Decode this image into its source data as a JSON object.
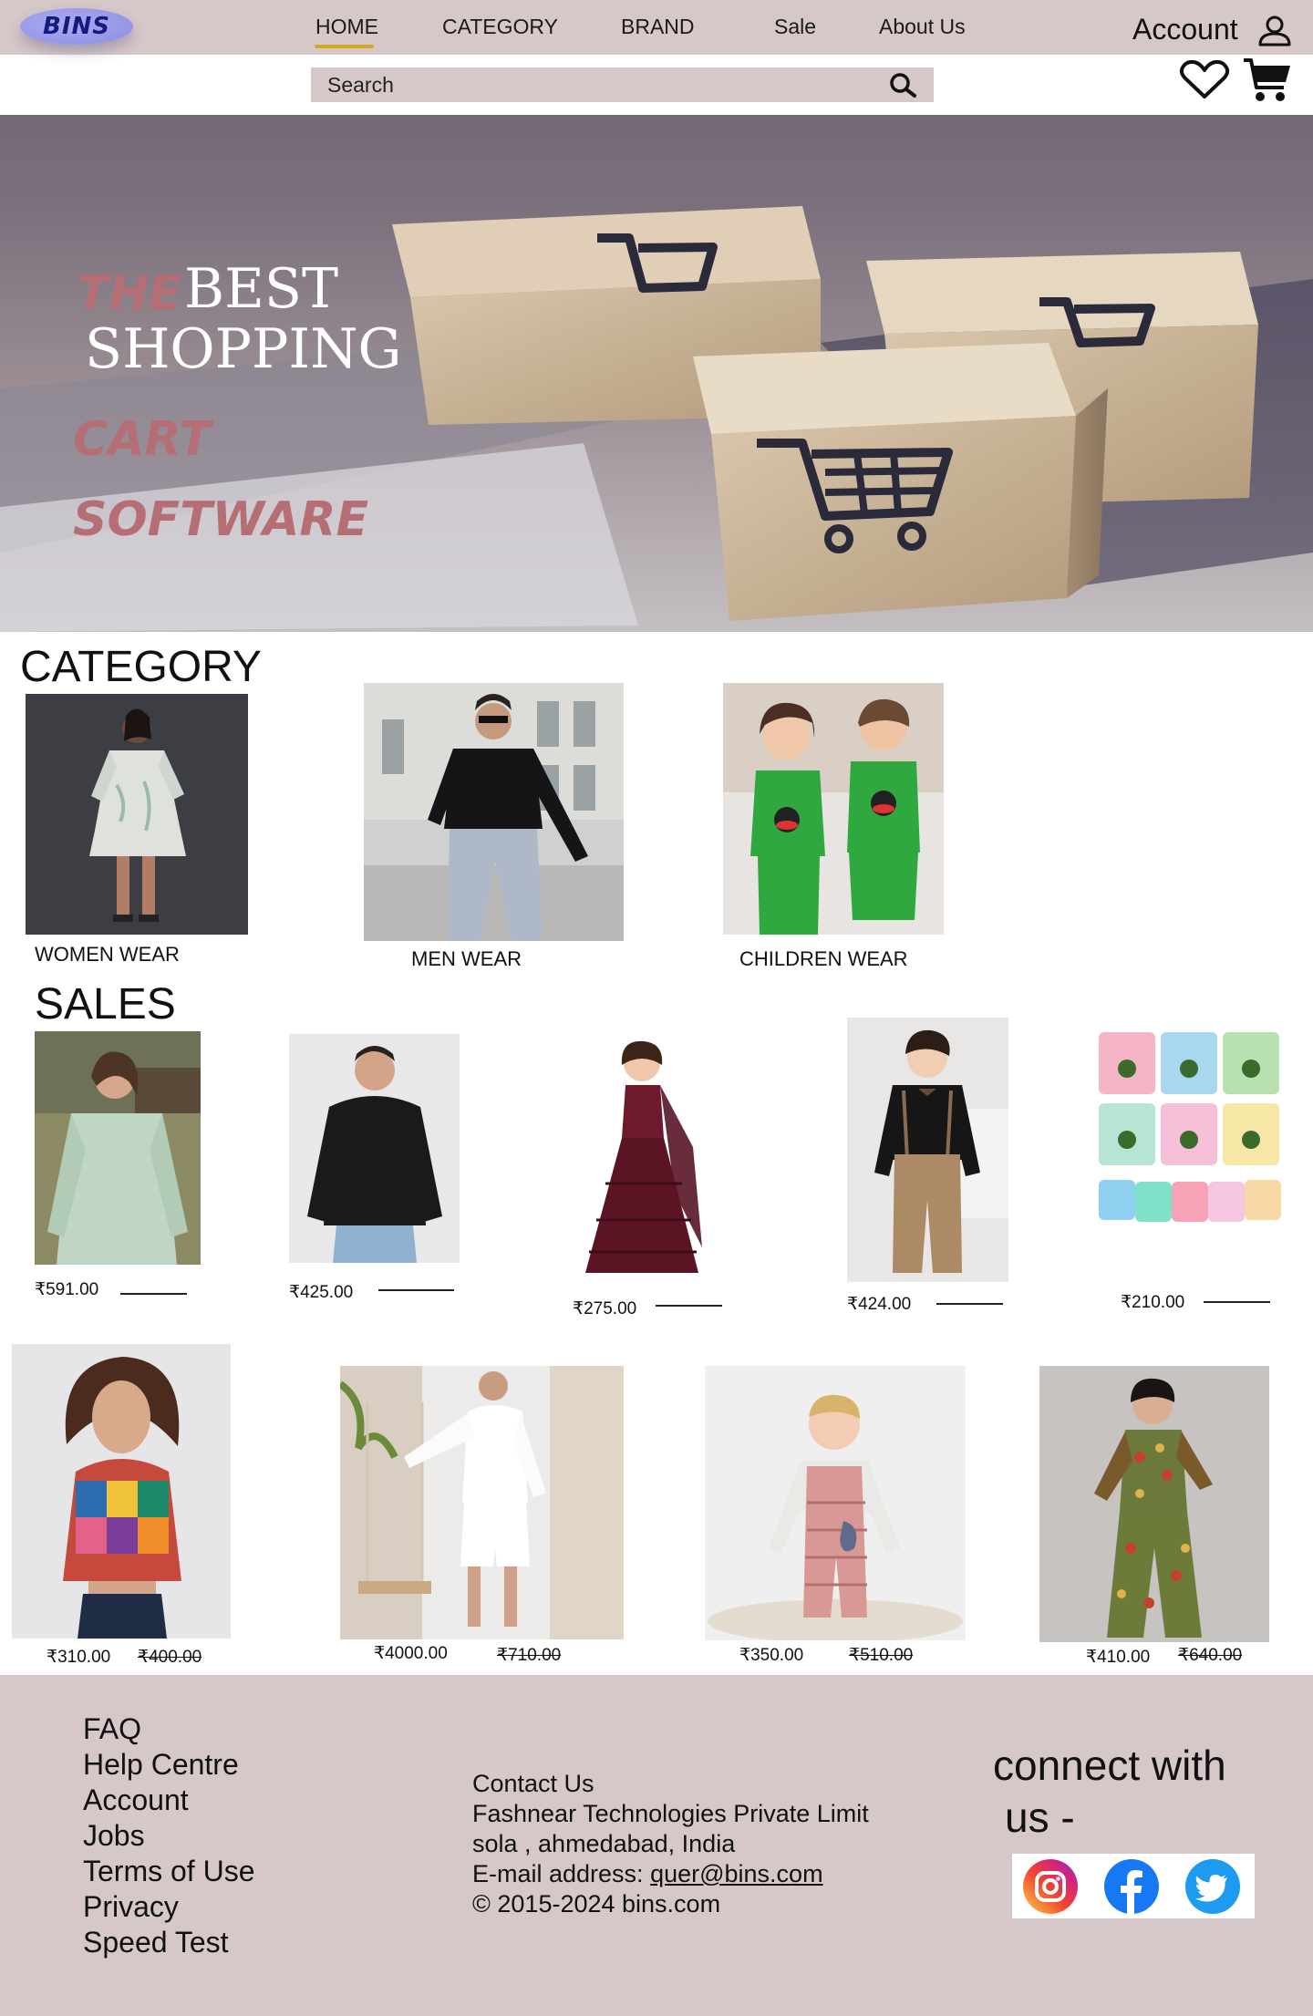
{
  "brand": {
    "logo_text": "BINS"
  },
  "nav": {
    "items": [
      {
        "label": "HOME",
        "active": true
      },
      {
        "label": "CATEGORY"
      },
      {
        "label": "BRAND"
      },
      {
        "label": "Sale"
      },
      {
        "label": "About Us"
      }
    ],
    "account_label": "Account"
  },
  "search": {
    "placeholder": "Search"
  },
  "hero": {
    "line1_a": "THE",
    "line1_b": "BEST",
    "line2": "SHOPPING",
    "line3": "CART",
    "line4": "SOFTWARE"
  },
  "category": {
    "title": "CATEGORY",
    "items": [
      {
        "label": "WOMEN WEAR"
      },
      {
        "label": "MEN WEAR"
      },
      {
        "label": "CHILDREN WEAR"
      }
    ]
  },
  "sales": {
    "title": "SALES",
    "row1": [
      {
        "price": "₹591.00"
      },
      {
        "price": "₹425.00"
      },
      {
        "price": "₹275.00"
      },
      {
        "price": "₹424.00"
      },
      {
        "price": "₹210.00"
      }
    ],
    "row2": [
      {
        "price": "₹310.00",
        "old_price": "₹400.00"
      },
      {
        "price": "₹4000.00",
        "old_price": "₹710.00"
      },
      {
        "price": "₹350.00",
        "old_price": "₹510.00"
      },
      {
        "price": "₹410.00",
        "old_price": "₹640.00"
      }
    ]
  },
  "footer": {
    "links": [
      "FAQ",
      "Help Centre",
      "Account",
      "Jobs",
      "Terms of Use",
      "Privacy",
      "Speed Test"
    ],
    "contact": {
      "heading": "Contact Us",
      "company": "Fashnear Technologies Private Limit",
      "address": "sola , ahmedabad, India",
      "email_label": "E-mail address: ",
      "email": "quer@bins.com",
      "copyright": "© 2015-2024 bins.com"
    },
    "connect_line1": "connect with",
    "connect_line2": "us -"
  },
  "colors": {
    "header_bg": "#d6c8c8",
    "nav_active_underline": "#d3a81a",
    "logo_bg": "#9b9cec",
    "logo_text": "#161a80",
    "hero_pink": "#b56e74",
    "footer_bg": "#d6c8c8"
  },
  "icons": [
    "account-icon",
    "search-icon",
    "heart-icon",
    "cart-icon",
    "instagram-icon",
    "facebook-icon",
    "twitter-icon"
  ]
}
